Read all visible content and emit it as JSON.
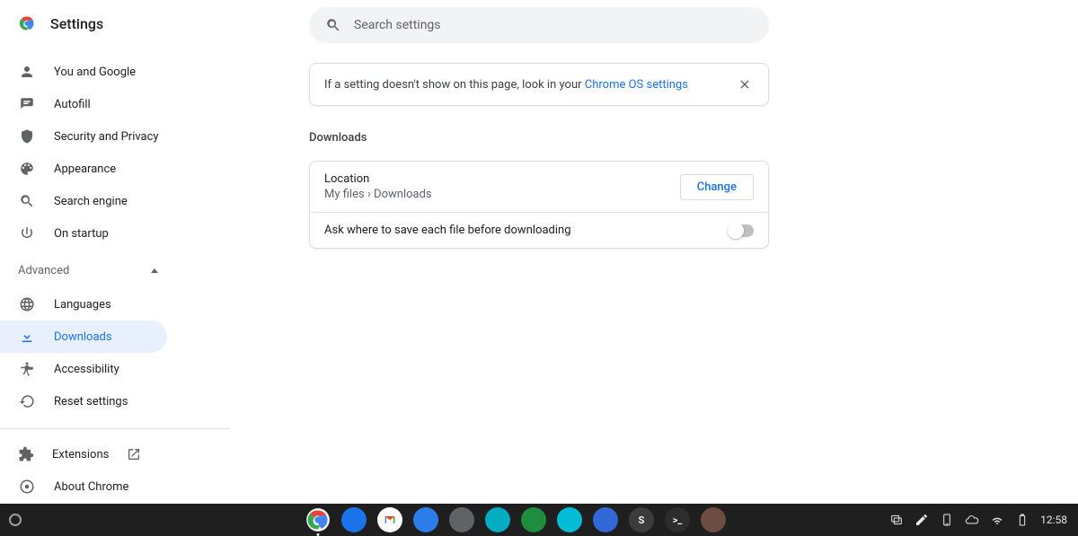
{
  "header": {
    "title": "Settings"
  },
  "search": {
    "placeholder": "Search settings"
  },
  "sidebar": {
    "items": [
      {
        "id": "you-google",
        "label": "You and Google"
      },
      {
        "id": "autofill",
        "label": "Autofill"
      },
      {
        "id": "security",
        "label": "Security and Privacy"
      },
      {
        "id": "appearance",
        "label": "Appearance"
      },
      {
        "id": "search-engine",
        "label": "Search engine"
      },
      {
        "id": "on-startup",
        "label": "On startup"
      }
    ],
    "advanced_label": "Advanced",
    "advanced_items": [
      {
        "id": "languages",
        "label": "Languages"
      },
      {
        "id": "downloads",
        "label": "Downloads",
        "selected": true
      },
      {
        "id": "accessibility",
        "label": "Accessibility"
      },
      {
        "id": "reset",
        "label": "Reset settings"
      }
    ],
    "footer_items": [
      {
        "id": "extensions",
        "label": "Extensions",
        "external": true
      },
      {
        "id": "about",
        "label": "About Chrome"
      }
    ]
  },
  "banner": {
    "text_prefix": "If a setting doesn't show on this page, look in your ",
    "link_text": "Chrome OS settings"
  },
  "section": {
    "title": "Downloads"
  },
  "downloads": {
    "location_label": "Location",
    "location_path": "My files › Downloads",
    "change_button": "Change",
    "ask_label": "Ask where to save each file before downloading",
    "ask_enabled": false
  },
  "shelf": {
    "apps": [
      {
        "name": "chrome",
        "color": ""
      },
      {
        "name": "messages",
        "color": "#1a73e8"
      },
      {
        "name": "gmail",
        "color": "#ffffff"
      },
      {
        "name": "calendar",
        "color": "#2b7de9"
      },
      {
        "name": "app-a",
        "color": "#5f6368"
      },
      {
        "name": "app-b",
        "color": "#00acc1"
      },
      {
        "name": "app-c",
        "color": "#1e8e3e"
      },
      {
        "name": "app-d",
        "color": "#00bcd4"
      },
      {
        "name": "app-e",
        "color": "#3367d6"
      },
      {
        "name": "sublime",
        "color": "#3c3c3c",
        "text": "S"
      },
      {
        "name": "terminal",
        "color": "#2d2d2d",
        "text": ">_"
      },
      {
        "name": "app-f",
        "color": "#6d4c41"
      }
    ],
    "clock": "12:58"
  }
}
